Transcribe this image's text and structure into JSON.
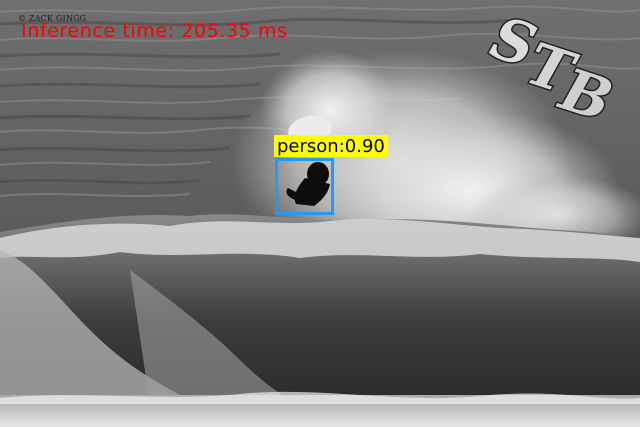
{
  "image": {
    "credit": "© ZACK GINGG",
    "inference_time": "Inference time: 205.35 ms",
    "inference_color": "#ff0000",
    "logo_text": "STB"
  },
  "detections": [
    {
      "label": "person:0.90",
      "class": "person",
      "score": 0.9,
      "box_color": "#1e9bff",
      "label_bg": "#ffff00"
    }
  ]
}
